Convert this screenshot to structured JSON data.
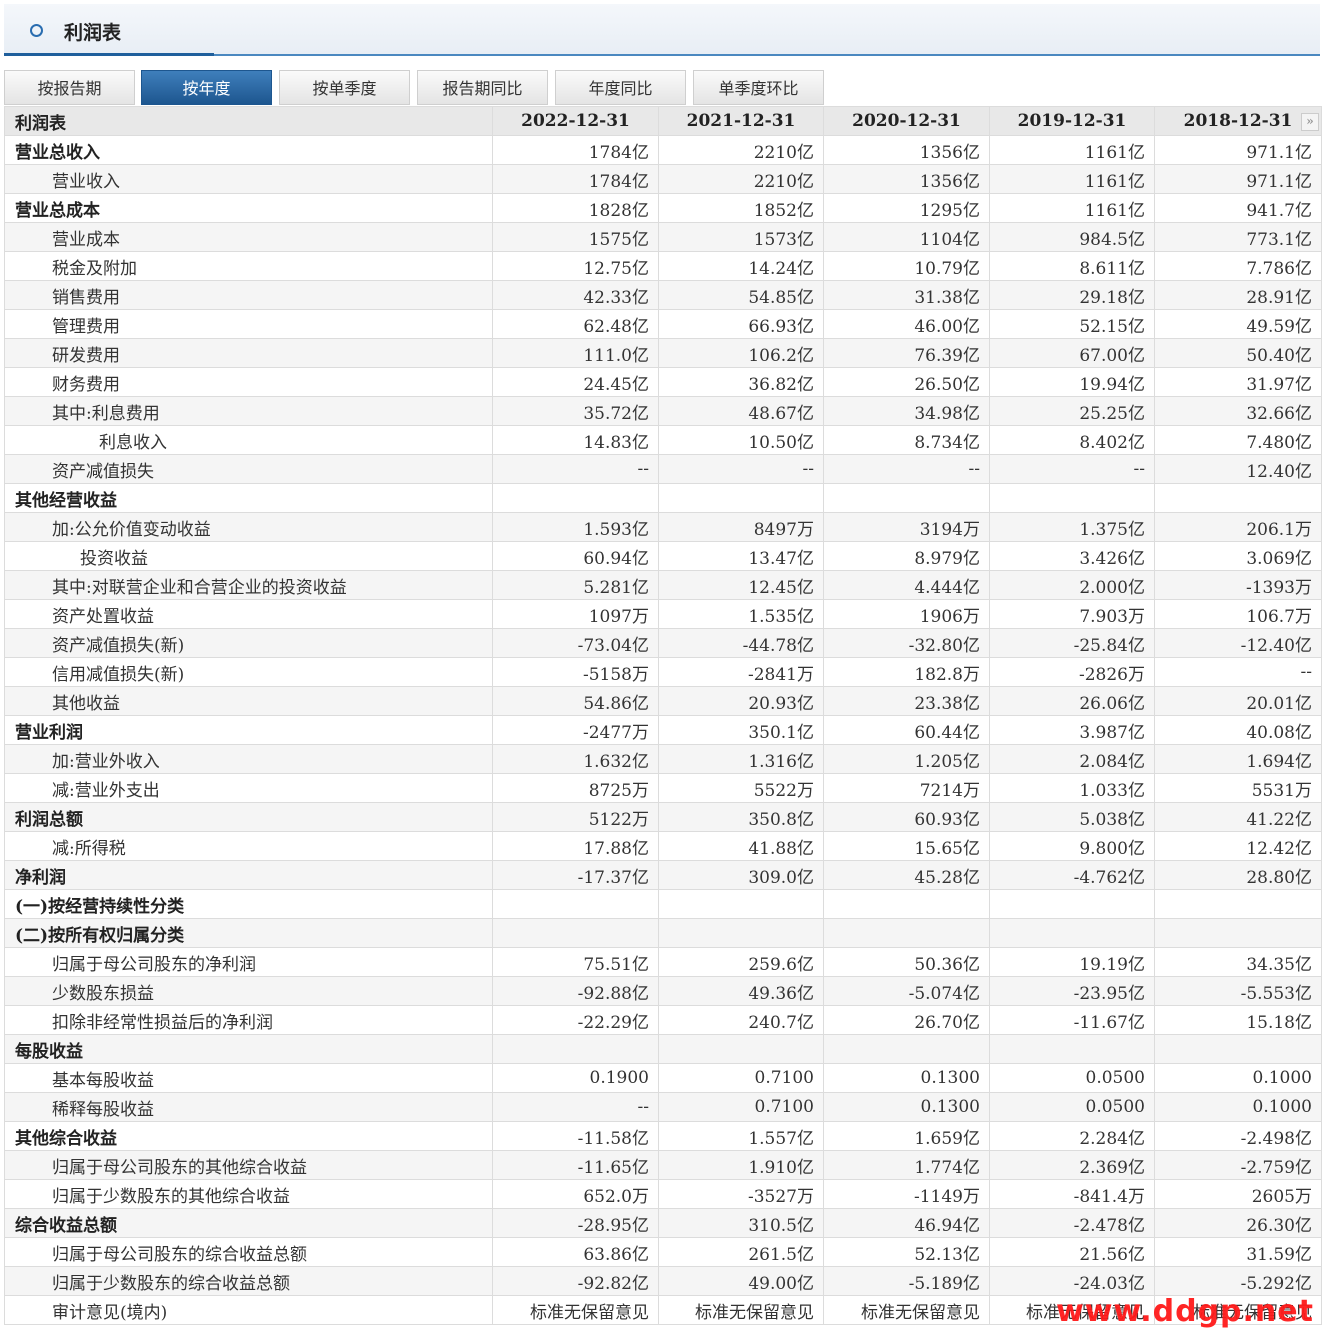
{
  "header": {
    "title": "利润表"
  },
  "tabs": [
    "按报告期",
    "按年度",
    "按单季度",
    "报告期同比",
    "年度同比",
    "单季度环比"
  ],
  "active_tab": 1,
  "table": {
    "corner": "利润表",
    "columns": [
      "2022-12-31",
      "2021-12-31",
      "2020-12-31",
      "2019-12-31",
      "2018-12-31"
    ],
    "rows": [
      {
        "label": "营业总收入",
        "bold": true,
        "indent": 0,
        "values": [
          "1784亿",
          "2210亿",
          "1356亿",
          "1161亿",
          "971.1亿"
        ]
      },
      {
        "label": "营业收入",
        "bold": false,
        "indent": 1,
        "values": [
          "1784亿",
          "2210亿",
          "1356亿",
          "1161亿",
          "971.1亿"
        ]
      },
      {
        "label": "营业总成本",
        "bold": true,
        "indent": 0,
        "values": [
          "1828亿",
          "1852亿",
          "1295亿",
          "1161亿",
          "941.7亿"
        ]
      },
      {
        "label": "营业成本",
        "bold": false,
        "indent": 1,
        "values": [
          "1575亿",
          "1573亿",
          "1104亿",
          "984.5亿",
          "773.1亿"
        ]
      },
      {
        "label": "税金及附加",
        "bold": false,
        "indent": 1,
        "values": [
          "12.75亿",
          "14.24亿",
          "10.79亿",
          "8.611亿",
          "7.786亿"
        ]
      },
      {
        "label": "销售费用",
        "bold": false,
        "indent": 1,
        "values": [
          "42.33亿",
          "54.85亿",
          "31.38亿",
          "29.18亿",
          "28.91亿"
        ]
      },
      {
        "label": "管理费用",
        "bold": false,
        "indent": 1,
        "values": [
          "62.48亿",
          "66.93亿",
          "46.00亿",
          "52.15亿",
          "49.59亿"
        ]
      },
      {
        "label": "研发费用",
        "bold": false,
        "indent": 1,
        "values": [
          "111.0亿",
          "106.2亿",
          "76.39亿",
          "67.00亿",
          "50.40亿"
        ]
      },
      {
        "label": "财务费用",
        "bold": false,
        "indent": 1,
        "values": [
          "24.45亿",
          "36.82亿",
          "26.50亿",
          "19.94亿",
          "31.97亿"
        ]
      },
      {
        "label": "其中:利息费用",
        "bold": false,
        "indent": 1,
        "values": [
          "35.72亿",
          "48.67亿",
          "34.98亿",
          "25.25亿",
          "32.66亿"
        ]
      },
      {
        "label": "利息收入",
        "bold": false,
        "indent": 3,
        "values": [
          "14.83亿",
          "10.50亿",
          "8.734亿",
          "8.402亿",
          "7.480亿"
        ]
      },
      {
        "label": "资产减值损失",
        "bold": false,
        "indent": 1,
        "values": [
          "--",
          "--",
          "--",
          "--",
          "12.40亿"
        ]
      },
      {
        "label": "其他经营收益",
        "bold": true,
        "indent": 0,
        "values": [
          "",
          "",
          "",
          "",
          ""
        ]
      },
      {
        "label": "加:公允价值变动收益",
        "bold": false,
        "indent": 1,
        "values": [
          "1.593亿",
          "8497万",
          "3194万",
          "1.375亿",
          "206.1万"
        ]
      },
      {
        "label": "投资收益",
        "bold": false,
        "indent": 2,
        "values": [
          "60.94亿",
          "13.47亿",
          "8.979亿",
          "3.426亿",
          "3.069亿"
        ]
      },
      {
        "label": "其中:对联营企业和合营企业的投资收益",
        "bold": false,
        "indent": 1,
        "values": [
          "5.281亿",
          "12.45亿",
          "4.444亿",
          "2.000亿",
          "-1393万"
        ]
      },
      {
        "label": "资产处置收益",
        "bold": false,
        "indent": 1,
        "values": [
          "1097万",
          "1.535亿",
          "1906万",
          "7.903万",
          "106.7万"
        ]
      },
      {
        "label": "资产减值损失(新)",
        "bold": false,
        "indent": 1,
        "values": [
          "-73.04亿",
          "-44.78亿",
          "-32.80亿",
          "-25.84亿",
          "-12.40亿"
        ]
      },
      {
        "label": "信用减值损失(新)",
        "bold": false,
        "indent": 1,
        "values": [
          "-5158万",
          "-2841万",
          "182.8万",
          "-2826万",
          "--"
        ]
      },
      {
        "label": "其他收益",
        "bold": false,
        "indent": 1,
        "values": [
          "54.86亿",
          "20.93亿",
          "23.38亿",
          "26.06亿",
          "20.01亿"
        ]
      },
      {
        "label": "营业利润",
        "bold": true,
        "indent": 0,
        "values": [
          "-2477万",
          "350.1亿",
          "60.44亿",
          "3.987亿",
          "40.08亿"
        ]
      },
      {
        "label": "加:营业外收入",
        "bold": false,
        "indent": 1,
        "values": [
          "1.632亿",
          "1.316亿",
          "1.205亿",
          "2.084亿",
          "1.694亿"
        ]
      },
      {
        "label": "减:营业外支出",
        "bold": false,
        "indent": 1,
        "values": [
          "8725万",
          "5522万",
          "7214万",
          "1.033亿",
          "5531万"
        ]
      },
      {
        "label": "利润总额",
        "bold": true,
        "indent": 0,
        "values": [
          "5122万",
          "350.8亿",
          "60.93亿",
          "5.038亿",
          "41.22亿"
        ]
      },
      {
        "label": "减:所得税",
        "bold": false,
        "indent": 1,
        "values": [
          "17.88亿",
          "41.88亿",
          "15.65亿",
          "9.800亿",
          "12.42亿"
        ]
      },
      {
        "label": "净利润",
        "bold": true,
        "indent": 0,
        "values": [
          "-17.37亿",
          "309.0亿",
          "45.28亿",
          "-4.762亿",
          "28.80亿"
        ]
      },
      {
        "label": "(一)按经营持续性分类",
        "bold": true,
        "indent": 0,
        "values": [
          "",
          "",
          "",
          "",
          ""
        ]
      },
      {
        "label": "(二)按所有权归属分类",
        "bold": true,
        "indent": 0,
        "values": [
          "",
          "",
          "",
          "",
          ""
        ]
      },
      {
        "label": "归属于母公司股东的净利润",
        "bold": false,
        "indent": 1,
        "values": [
          "75.51亿",
          "259.6亿",
          "50.36亿",
          "19.19亿",
          "34.35亿"
        ]
      },
      {
        "label": "少数股东损益",
        "bold": false,
        "indent": 1,
        "values": [
          "-92.88亿",
          "49.36亿",
          "-5.074亿",
          "-23.95亿",
          "-5.553亿"
        ]
      },
      {
        "label": "扣除非经常性损益后的净利润",
        "bold": false,
        "indent": 1,
        "values": [
          "-22.29亿",
          "240.7亿",
          "26.70亿",
          "-11.67亿",
          "15.18亿"
        ]
      },
      {
        "label": "每股收益",
        "bold": true,
        "indent": 0,
        "values": [
          "",
          "",
          "",
          "",
          ""
        ]
      },
      {
        "label": "基本每股收益",
        "bold": false,
        "indent": 1,
        "values": [
          "0.1900",
          "0.7100",
          "0.1300",
          "0.0500",
          "0.1000"
        ]
      },
      {
        "label": "稀释每股收益",
        "bold": false,
        "indent": 1,
        "values": [
          "--",
          "0.7100",
          "0.1300",
          "0.0500",
          "0.1000"
        ]
      },
      {
        "label": "其他综合收益",
        "bold": true,
        "indent": 0,
        "values": [
          "-11.58亿",
          "1.557亿",
          "1.659亿",
          "2.284亿",
          "-2.498亿"
        ]
      },
      {
        "label": "归属于母公司股东的其他综合收益",
        "bold": false,
        "indent": 1,
        "values": [
          "-11.65亿",
          "1.910亿",
          "1.774亿",
          "2.369亿",
          "-2.759亿"
        ]
      },
      {
        "label": "归属于少数股东的其他综合收益",
        "bold": false,
        "indent": 1,
        "values": [
          "652.0万",
          "-3527万",
          "-1149万",
          "-841.4万",
          "2605万"
        ]
      },
      {
        "label": "综合收益总额",
        "bold": true,
        "indent": 0,
        "values": [
          "-28.95亿",
          "310.5亿",
          "46.94亿",
          "-2.478亿",
          "26.30亿"
        ]
      },
      {
        "label": "归属于母公司股东的综合收益总额",
        "bold": false,
        "indent": 1,
        "values": [
          "63.86亿",
          "261.5亿",
          "52.13亿",
          "21.56亿",
          "31.59亿"
        ]
      },
      {
        "label": "归属于少数股东的综合收益总额",
        "bold": false,
        "indent": 1,
        "values": [
          "-92.82亿",
          "49.00亿",
          "-5.189亿",
          "-24.03亿",
          "-5.292亿"
        ]
      },
      {
        "label": "审计意见(境内)",
        "bold": false,
        "indent": 1,
        "values": [
          "标准无保留意见",
          "标准无保留意见",
          "标准无保留意见",
          "标准无保留意见",
          "标准无保留意见"
        ]
      }
    ]
  },
  "scroll_icon": "double-chevron-right-icon",
  "scroll_glyph": "»",
  "watermark": "www.ddgp.net",
  "colors": {
    "accent": "#1d568f",
    "watermark": "#ff1a1a"
  }
}
